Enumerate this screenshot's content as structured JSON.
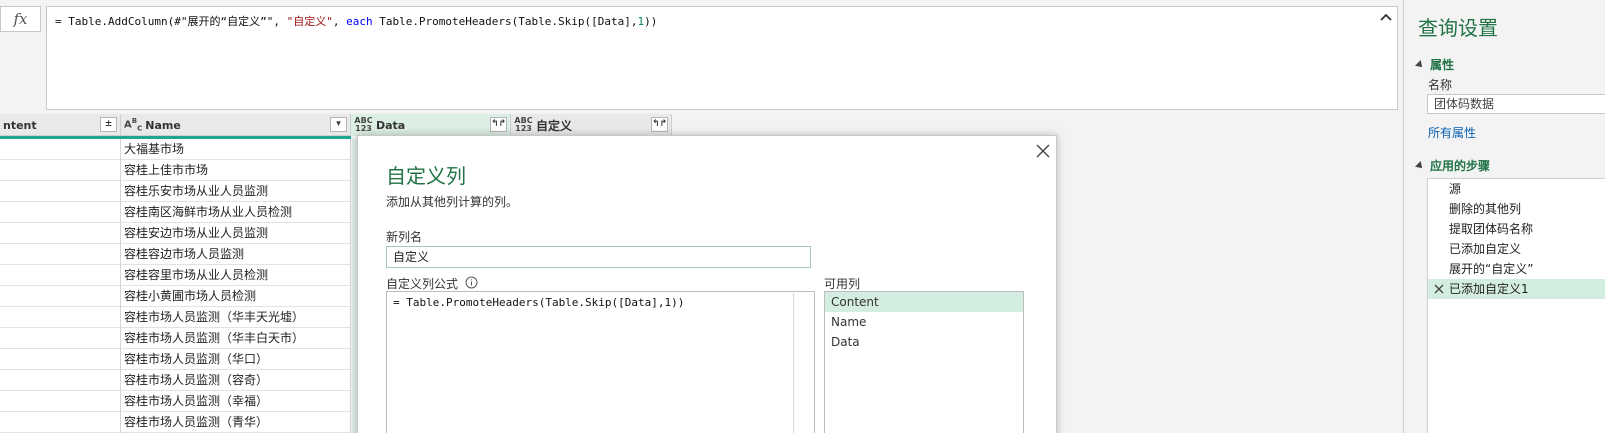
{
  "formula_bar": {
    "fx_label": "fx",
    "tokens": {
      "t1": "= Table.AddColumn(#\"展开的“自定义”\", ",
      "t2": "\"自定义\"",
      "t3": ", ",
      "t4": "each",
      "t5": " Table.PromoteHeaders(Table.Skip([Data],",
      "t6": "1",
      "t7": "))"
    }
  },
  "grid": {
    "columns": [
      {
        "name": "ntent",
        "type": "",
        "button": "±"
      },
      {
        "name": "Name",
        "type": "ABC",
        "button": "▾"
      },
      {
        "name": "Data",
        "type": "ABC 123",
        "button": "↰↱"
      },
      {
        "name": "自定义",
        "type": "ABC 123",
        "button": "↰↱"
      }
    ],
    "rows": [
      "大福基市场",
      "容桂上佳市市场",
      "容桂乐安市场从业人员监测",
      "容桂南区海鲜市场从业人员检测",
      "容桂安边市场从业人员监测",
      "容桂容边市场人员监测",
      "容桂容里市场从业人员检测",
      "容桂小黄圃市场人员检测",
      "容桂市场人员监测（华丰天光墟）",
      "容桂市场人员监测（华丰白天市）",
      "容桂市场人员监测（华口）",
      "容桂市场人员监测（容奇）",
      "容桂市场人员监测（幸福）",
      "容桂市场人员监测（青华）"
    ]
  },
  "dialog": {
    "title": "自定义列",
    "subtitle": "添加从其他列计算的列。",
    "new_col_label": "新列名",
    "new_col_value": "自定义",
    "formula_label": "自定义列公式",
    "formula_value": "= Table.PromoteHeaders(Table.Skip([Data],1))",
    "available_label": "可用列",
    "available_columns": [
      "Content",
      "Name",
      "Data"
    ],
    "selected_column_index": 0
  },
  "query_settings": {
    "title": "查询设置",
    "properties_header": "属性",
    "name_label": "名称",
    "name_value": "团体码数据",
    "all_properties_link": "所有属性",
    "applied_steps_header": "应用的步骤",
    "steps": [
      "源",
      "删除的其他列",
      "提取团体码名称",
      "已添加自定义",
      "展开的“自定义”",
      "已添加自定义1"
    ],
    "active_step_index": 5
  },
  "colors": {
    "accent_green": "#217346",
    "teal_bar": "#1fa68c",
    "selection_bg": "#d3ede0",
    "link_blue": "#0b62b4"
  }
}
